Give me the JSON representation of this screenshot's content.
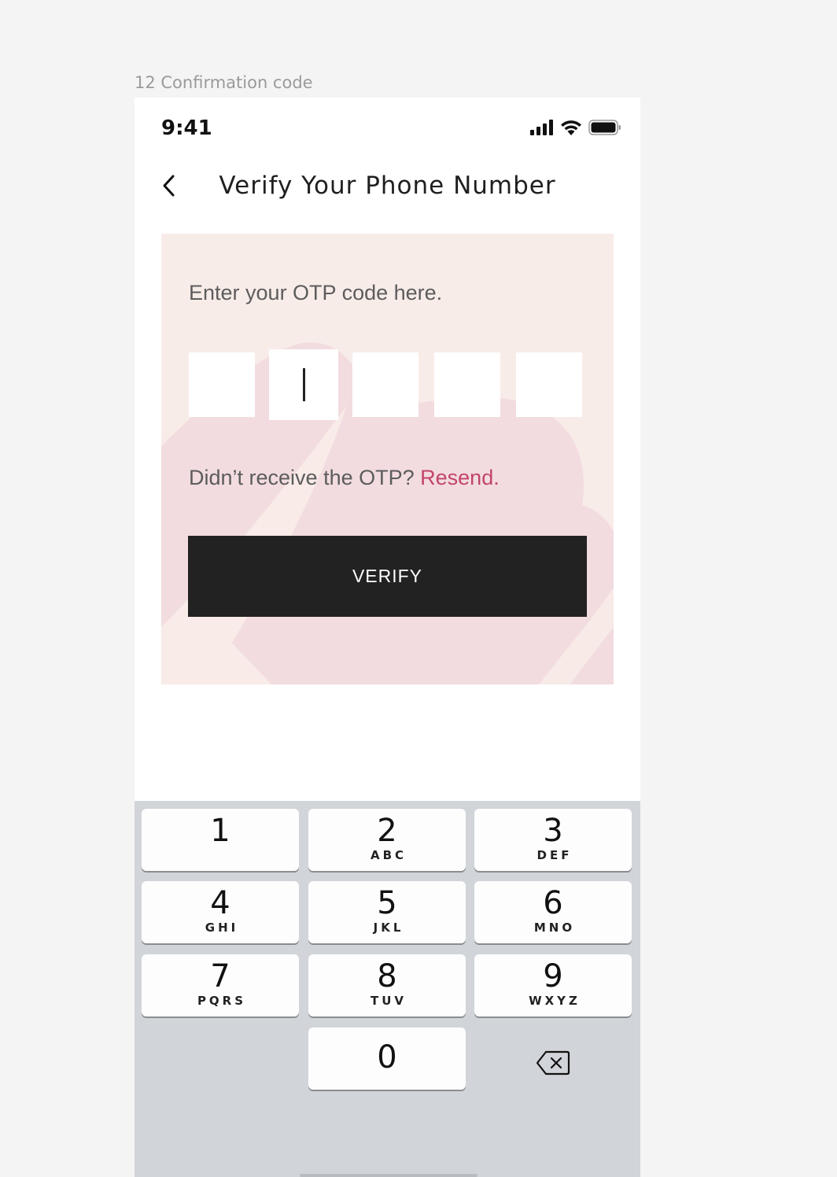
{
  "frame_label": "12 Confirmation code",
  "status_bar": {
    "time": "9:41",
    "icons": [
      "cellular-signal-icon",
      "wifi-icon",
      "battery-icon"
    ]
  },
  "nav": {
    "back_icon": "chevron-left-icon",
    "title": "Verify Your Phone Number"
  },
  "otp": {
    "prompt": "Enter your OTP code here.",
    "boxes": [
      "",
      "",
      "",
      "",
      ""
    ],
    "active_index": 1,
    "resend_question": "Didn’t receive the OTP?",
    "resend_link": "Resend.",
    "verify_label": "VERIFY"
  },
  "colors": {
    "card_bg": "#f8ece9",
    "card_shape": "#f2dcdf",
    "link": "#c2446c",
    "button_bg": "#222222",
    "keyboard_bg": "#d1d4d9"
  },
  "keypad": {
    "keys": [
      {
        "digit": "1",
        "letters": ""
      },
      {
        "digit": "2",
        "letters": "ABC"
      },
      {
        "digit": "3",
        "letters": "DEF"
      },
      {
        "digit": "4",
        "letters": "GHI"
      },
      {
        "digit": "5",
        "letters": "JKL"
      },
      {
        "digit": "6",
        "letters": "MNO"
      },
      {
        "digit": "7",
        "letters": "PQRS"
      },
      {
        "digit": "8",
        "letters": "TUV"
      },
      {
        "digit": "9",
        "letters": "WXYZ"
      },
      {
        "digit": "0",
        "letters": ""
      }
    ],
    "delete_icon": "backspace-icon"
  }
}
